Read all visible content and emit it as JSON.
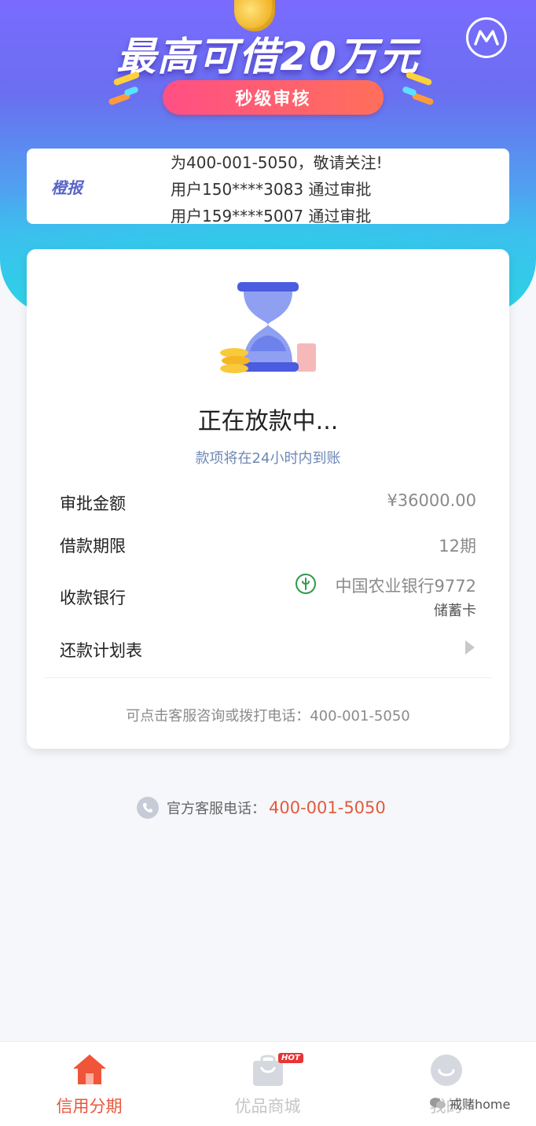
{
  "header": {
    "title": "最高可借20万元",
    "pill_label": "秒级审核",
    "logo_icon": "m-logo-icon"
  },
  "ticker": {
    "tag": "橙报",
    "lines": [
      "为400-001-5050，敬请关注!",
      "用户150****3083 通过审批",
      "用户159****5007 通过审批"
    ]
  },
  "status": {
    "icon": "hourglass-icon",
    "title": "正在放款中...",
    "subtitle": "款项将在24小时内到账"
  },
  "details": {
    "amount_label": "审批金额",
    "amount_value": "¥36000.00",
    "term_label": "借款期限",
    "term_value": "12期",
    "bank_label": "收款银行",
    "bank_value": "中国农业银行9772",
    "bank_card_type": "储蓄卡",
    "bank_icon": "agricultural-bank-icon",
    "plan_label": "还款计划表"
  },
  "help_text": "可点击客服咨询或拨打电话：400-001-5050",
  "service": {
    "label": "官方客服电话：",
    "number": "400-001-5050"
  },
  "nav": {
    "items": [
      {
        "label": "信用分期",
        "icon": "home-icon",
        "active": true
      },
      {
        "label": "优品商城",
        "icon": "shopping-bag-icon",
        "badge": "HOT",
        "active": false
      },
      {
        "label": "我的",
        "icon": "user-icon",
        "active": false
      }
    ]
  },
  "watermark": "戒赌home",
  "colors": {
    "accent": "#e8563a",
    "banner_top": "#7a6bff",
    "banner_bottom": "#2fd3e7",
    "pill": "#ff5b78",
    "link_blue": "#6d88b5"
  }
}
